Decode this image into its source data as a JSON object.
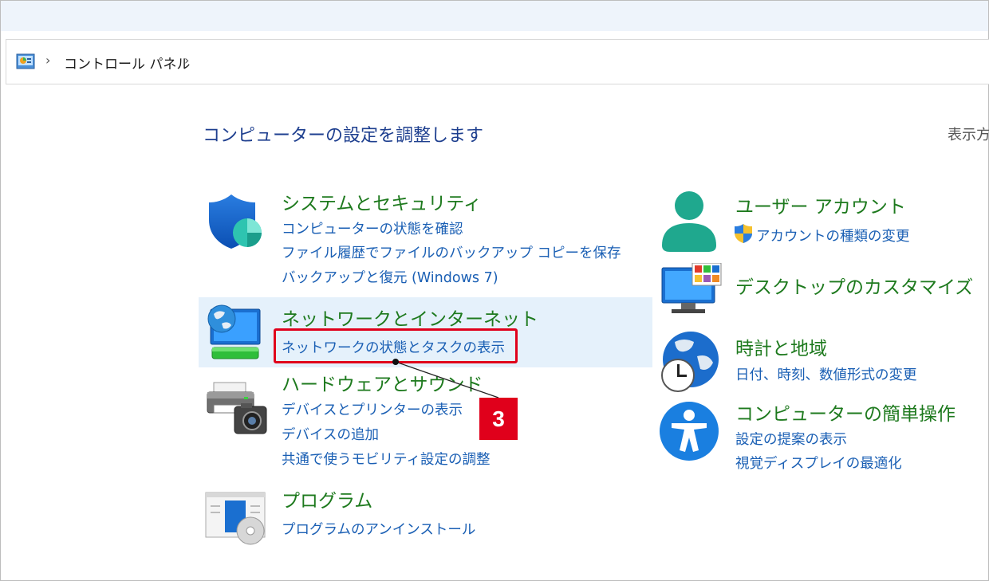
{
  "breadcrumb": {
    "root_icon": "control-panel-icon",
    "separator": "›",
    "items": [
      "コントロール パネル"
    ]
  },
  "page": {
    "title": "コンピューターの設定を調整します",
    "view_by_label": "表示方"
  },
  "categories": {
    "system_security": {
      "icon": "shield-icon",
      "title": "システムとセキュリティ",
      "links": [
        "コンピューターの状態を確認",
        "ファイル履歴でファイルのバックアップ コピーを保存",
        "バックアップと復元 (Windows 7)"
      ]
    },
    "network": {
      "icon": "network-globe-icon",
      "title": "ネットワークとインターネット",
      "links": [
        "ネットワークの状態とタスクの表示"
      ]
    },
    "hardware": {
      "icon": "printer-camera-icon",
      "title": "ハードウェアとサウンド",
      "links": [
        "デバイスとプリンターの表示",
        "デバイスの追加",
        "共通で使うモビリティ設定の調整"
      ]
    },
    "programs": {
      "icon": "programs-disc-icon",
      "title": "プログラム",
      "links": [
        "プログラムのアンインストール"
      ]
    },
    "user_accounts": {
      "icon": "user-icon",
      "title": "ユーザー アカウント",
      "links": [
        "アカウントの種類の変更"
      ]
    },
    "personalization": {
      "icon": "monitor-colors-icon",
      "title": "デスクトップのカスタマイズ",
      "links": []
    },
    "clock_region": {
      "icon": "clock-globe-icon",
      "title": "時計と地域",
      "links": [
        "日付、時刻、数値形式の変更"
      ]
    },
    "ease_of_access": {
      "icon": "accessibility-icon",
      "title": "コンピューターの簡単操作",
      "links": [
        "設定の提案の表示",
        "視覚ディスプレイの最適化"
      ]
    }
  },
  "annotation": {
    "step_number": "3",
    "color": "#e0001b"
  },
  "colors": {
    "title_blue": "#1e3f8f",
    "category_green": "#1e7a1e",
    "link_blue": "#1a5fb4",
    "hover_row": "#e5f1fb"
  }
}
